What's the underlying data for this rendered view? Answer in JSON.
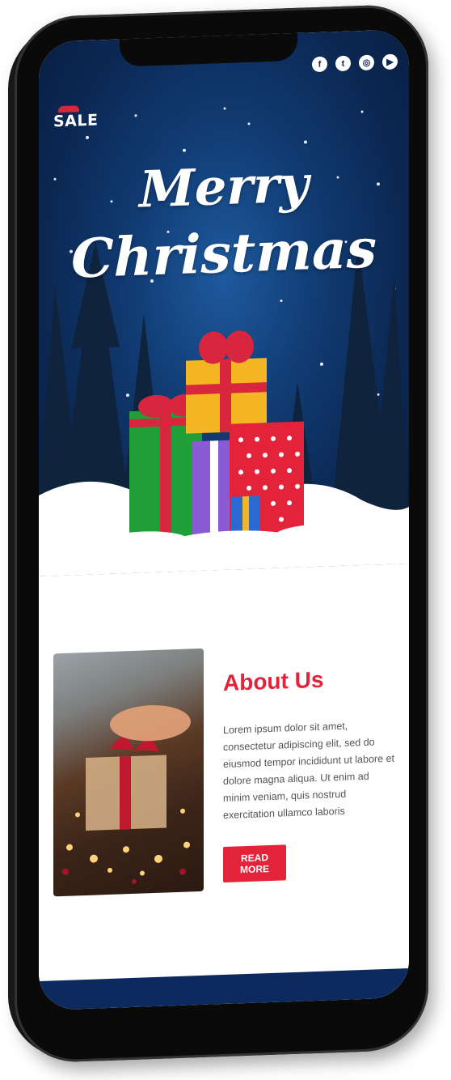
{
  "header": {
    "logo_text": "SALE",
    "social_icons": [
      "facebook-icon",
      "twitter-icon",
      "instagram-icon",
      "youtube-icon"
    ]
  },
  "hero": {
    "title_line1": "Merry",
    "title_line2": "Christmas"
  },
  "about": {
    "heading": "About Us",
    "body": "Lorem ipsum dolor sit amet, consectetur adipiscing elit, sed do eiusmod tempor incididunt ut labore et dolore magna aliqua. Ut enim ad minim veniam, quis nostrud exercitation ullamco laboris",
    "button_label": "READ MORE"
  },
  "colors": {
    "accent": "#e3233a",
    "night_sky": "#0b2752"
  }
}
